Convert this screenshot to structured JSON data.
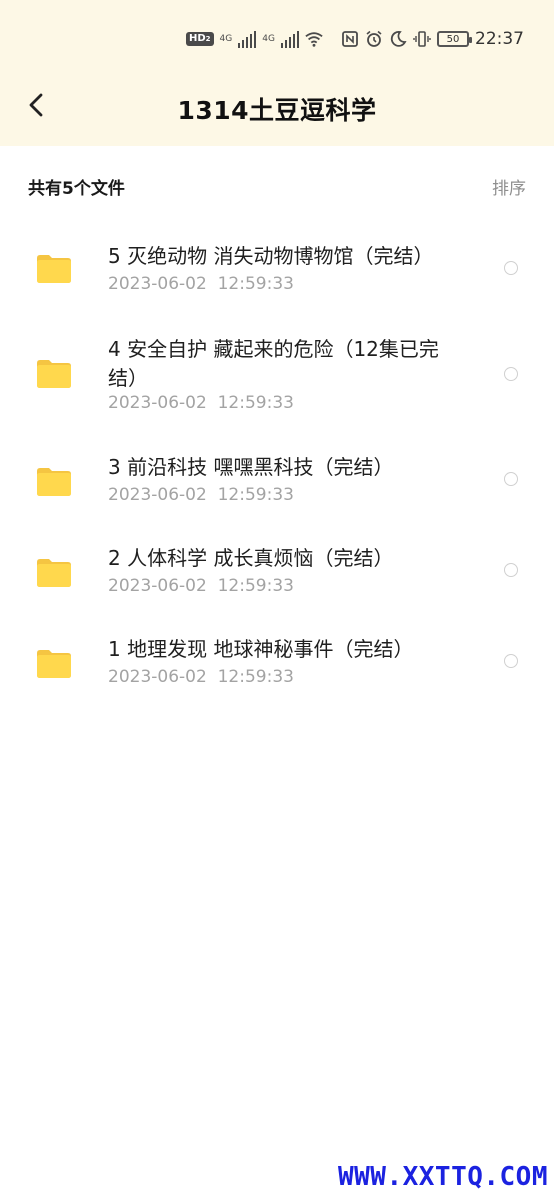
{
  "status_bar": {
    "hd_label": "HD",
    "hd_sub": "2",
    "net1": "4G",
    "net2": "4G",
    "battery_level": "50",
    "time": "22:37"
  },
  "header": {
    "title": "1314土豆逗科学"
  },
  "summary": {
    "count_label": "共有5个文件",
    "sort_label": "排序"
  },
  "files": [
    {
      "name": "5 灭绝动物 消失动物博物馆（完结）",
      "date": "2023-06-02  12:59:33"
    },
    {
      "name": "4 安全自护 藏起来的危险（12集已完结）",
      "date": "2023-06-02  12:59:33"
    },
    {
      "name": "3 前沿科技 嘿嘿黑科技（完结）",
      "date": "2023-06-02  12:59:33"
    },
    {
      "name": "2 人体科学 成长真烦恼（完结）",
      "date": "2023-06-02  12:59:33"
    },
    {
      "name": "1 地理发现 地球神秘事件（完结）",
      "date": "2023-06-02  12:59:33"
    }
  ],
  "watermark": "WWW.XXTTQ.COM",
  "colors": {
    "header_bg": "#FDF8E6",
    "folder": "#FFD84D",
    "folder_tab": "#F5C542",
    "date_text": "#A3A3A3",
    "watermark": "#1B22E0"
  }
}
